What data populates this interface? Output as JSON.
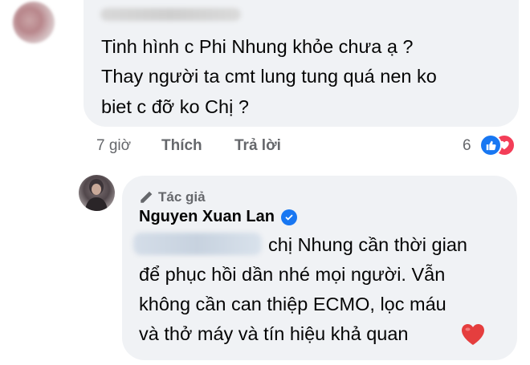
{
  "comment": {
    "lines": [
      "Tinh hình c Phi Nhung khỏe chưa ạ ?",
      "Thay người ta cmt lung tung quá nen ko",
      "biet c đỡ ko Chị ?"
    ],
    "time": "7 giờ",
    "like_label": "Thích",
    "reply_label": "Trả lời",
    "reaction_count": "6",
    "reaction_icons": [
      "like-icon",
      "love-icon"
    ]
  },
  "reply": {
    "author_badge": "Tác giả",
    "author_name": "Nguyen Xuan Lan",
    "lines": [
      "chị Nhung cần thời gian",
      "để phục hồi dần nhé mọi người. Vẫn",
      "không cần can thiệp ECMO, lọc máu",
      "và thở máy và tín hiệu khả quan"
    ],
    "emoji": "heart-emoji"
  },
  "colors": {
    "bubble": "#f0f2f5",
    "meta_text": "#65676b",
    "like_blue": "#1877f2",
    "love_red": "#f33e58",
    "heart": "#e53e3e"
  }
}
